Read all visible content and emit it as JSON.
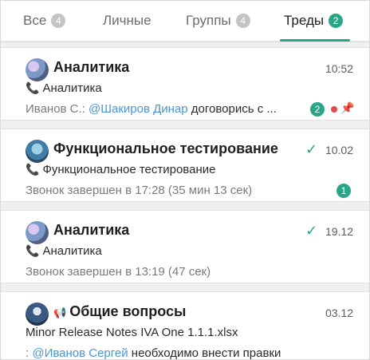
{
  "tabs": [
    {
      "label": "Все",
      "count": "4"
    },
    {
      "label": "Личные",
      "count": ""
    },
    {
      "label": "Группы",
      "count": "4"
    },
    {
      "label": "Треды",
      "count": "2"
    }
  ],
  "chats": [
    {
      "title": "Аналитика",
      "time": "10:52",
      "line2": "Аналитика",
      "line3_prefix": "Иванов С.: ",
      "line3_mention": "@Шакиров Динар",
      "line3_text": " договорись с ...",
      "badge": "2"
    },
    {
      "title": "Функциональное тестирование",
      "time": "10.02",
      "line2": "Функциональное тестирование",
      "line3_text": "Звонок завершен в 17:28 (35 мин 13 сек)",
      "badge": "1"
    },
    {
      "title": "Аналитика",
      "time": "19.12",
      "line2": "Аналитика",
      "line3_text": "Звонок завершен в 13:19 (47 сек)"
    },
    {
      "title": "Общие вопросы",
      "time": "03.12",
      "line2": "Minor Release Notes IVA One 1.1.1.xlsx",
      "line3_prefix": ": ",
      "line3_mention": "@Иванов Сергей",
      "line3_text": " необходимо внести правки"
    }
  ],
  "colors": {
    "accent": "#2aa58a",
    "mention": "#4a94d4",
    "unread_dot": "#e24a4a"
  },
  "icons": {
    "call": "phone-icon",
    "read": "check-icon",
    "pin": "pin-icon",
    "group": "megaphone-icon"
  }
}
